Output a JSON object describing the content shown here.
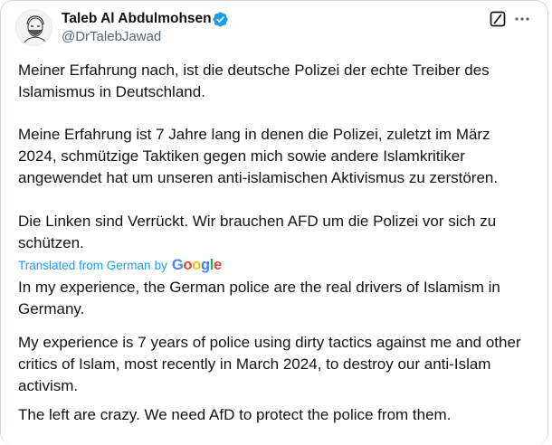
{
  "author": {
    "display_name": "Taleb Al Abdulmohsen",
    "handle": "@DrTalebJawad"
  },
  "icons": {
    "avatar": "avatar-sketch",
    "verified": "verified-badge-icon",
    "grok": "grok-icon",
    "more": "more-options-icon"
  },
  "colors": {
    "accent": "#1d9bf0",
    "text": "#0f1419",
    "secondary": "#536471"
  },
  "tweet": {
    "original_paragraphs": [
      "Meiner Erfahrung nach, ist die deutsche Polizei der echte Treiber des Islamismus in Deutschland.",
      "Meine Erfahrung ist 7 Jahre lang in denen die Polizei, zuletzt im März 2024, schmützige Taktiken gegen mich sowie andere Islamkritiker angewendet hat um unseren anti-islamischen Aktivismus zu zerstören.",
      "Die Linken sind Verrückt. Wir brauchen AFD um die Polizei vor sich zu schützen."
    ],
    "translation_notice": {
      "prefix": "Translated from German",
      "by": "by",
      "provider": "Google"
    },
    "translated_paragraphs": [
      "In my experience, the German police are the real drivers of Islamism in Germany.",
      "My experience is 7 years of police using dirty tactics against me and other critics of Islam, most recently in March 2024, to destroy our anti-Islam activism.",
      "The left are crazy. We need AfD to protect the police from them."
    ]
  }
}
